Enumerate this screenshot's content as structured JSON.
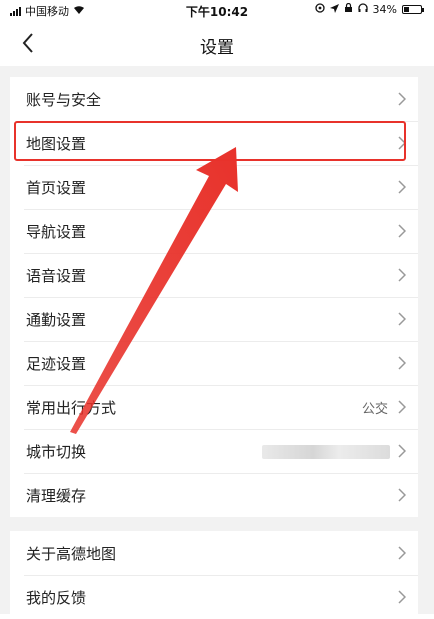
{
  "status_bar": {
    "carrier": "中国移动",
    "time": "下午10:42",
    "battery_percent": "34%",
    "battery_level": 0.34
  },
  "nav": {
    "title": "设置"
  },
  "settings": {
    "group1": [
      {
        "label": "账号与安全",
        "value": ""
      },
      {
        "label": "地图设置",
        "value": ""
      },
      {
        "label": "首页设置",
        "value": ""
      },
      {
        "label": "导航设置",
        "value": ""
      },
      {
        "label": "语音设置",
        "value": ""
      },
      {
        "label": "通勤设置",
        "value": ""
      },
      {
        "label": "足迹设置",
        "value": ""
      },
      {
        "label": "常用出行方式",
        "value": "公交"
      },
      {
        "label": "城市切换",
        "value": ""
      },
      {
        "label": "清理缓存",
        "value": ""
      }
    ],
    "group2": [
      {
        "label": "关于高德地图",
        "value": ""
      },
      {
        "label": "我的反馈",
        "value": ""
      }
    ]
  },
  "colors": {
    "annotation_red": "#e8322b",
    "background_gray": "#f2f2f2"
  }
}
